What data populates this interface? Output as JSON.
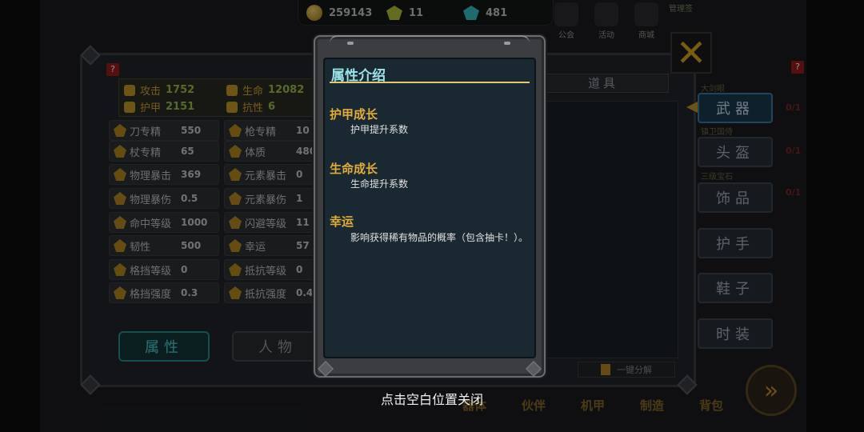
{
  "resources": [
    {
      "icon": "gold-coin-icon",
      "value": "259143"
    },
    {
      "icon": "yellow-gem-icon",
      "value": "11"
    },
    {
      "icon": "diamond-icon",
      "value": "481"
    }
  ],
  "top_menu": [
    "公会",
    "活动",
    "商城"
  ],
  "top_tag": "管理签",
  "stats_header": [
    {
      "label": "攻击",
      "value": "1752"
    },
    {
      "label": "生命",
      "value": "12082"
    },
    {
      "label": "护甲",
      "value": "2151"
    },
    {
      "label": "抗性",
      "value": "6"
    }
  ],
  "stats_left": [
    {
      "label": "刀专精",
      "value": "550"
    },
    {
      "label": "杖专精",
      "value": "65"
    },
    {
      "label": "物理暴击",
      "value": "369"
    },
    {
      "label": "物理暴伤",
      "value": "0.5"
    },
    {
      "label": "命中等级",
      "value": "1000"
    },
    {
      "label": "韧性",
      "value": "500"
    },
    {
      "label": "格挡等级",
      "value": "0"
    },
    {
      "label": "格挡强度",
      "value": "0.3"
    }
  ],
  "stats_right": [
    {
      "label": "枪专精",
      "value": "10"
    },
    {
      "label": "体质",
      "value": "480"
    },
    {
      "label": "元素暴击",
      "value": "0"
    },
    {
      "label": "元素暴伤",
      "value": "1"
    },
    {
      "label": "闪避等级",
      "value": "11"
    },
    {
      "label": "幸运",
      "value": "57"
    },
    {
      "label": "抵抗等级",
      "value": "0"
    },
    {
      "label": "抵抗强度",
      "value": "0.4"
    }
  ],
  "tabs": {
    "attributes": "属性",
    "character": "人物"
  },
  "inventory": {
    "dropdown": "道具",
    "salvage": "一键分解"
  },
  "equip_slots": [
    {
      "label": "武器",
      "tag": "大剑眼",
      "count": "0/1"
    },
    {
      "label": "头盔",
      "tag": "镇卫国侍",
      "count": "0/1"
    },
    {
      "label": "饰品",
      "tag": "三级宝石",
      "count": "0/1"
    },
    {
      "label": "护手",
      "tag": "",
      "count": ""
    },
    {
      "label": "鞋子",
      "tag": "",
      "count": ""
    },
    {
      "label": "时装",
      "tag": "",
      "count": ""
    }
  ],
  "bottom_nav": [
    "器体",
    "伙伴",
    "机甲",
    "制造",
    "背包"
  ],
  "popup": {
    "title": "属性介绍",
    "sections": [
      {
        "title": "护甲成长",
        "desc": "护甲提升系数"
      },
      {
        "title": "生命成长",
        "desc": "生命提升系数"
      },
      {
        "title": "幸运",
        "desc": "影响获得稀有物品的概率（包含抽卡！）。"
      }
    ]
  },
  "hint": "点击空白位置关闭"
}
